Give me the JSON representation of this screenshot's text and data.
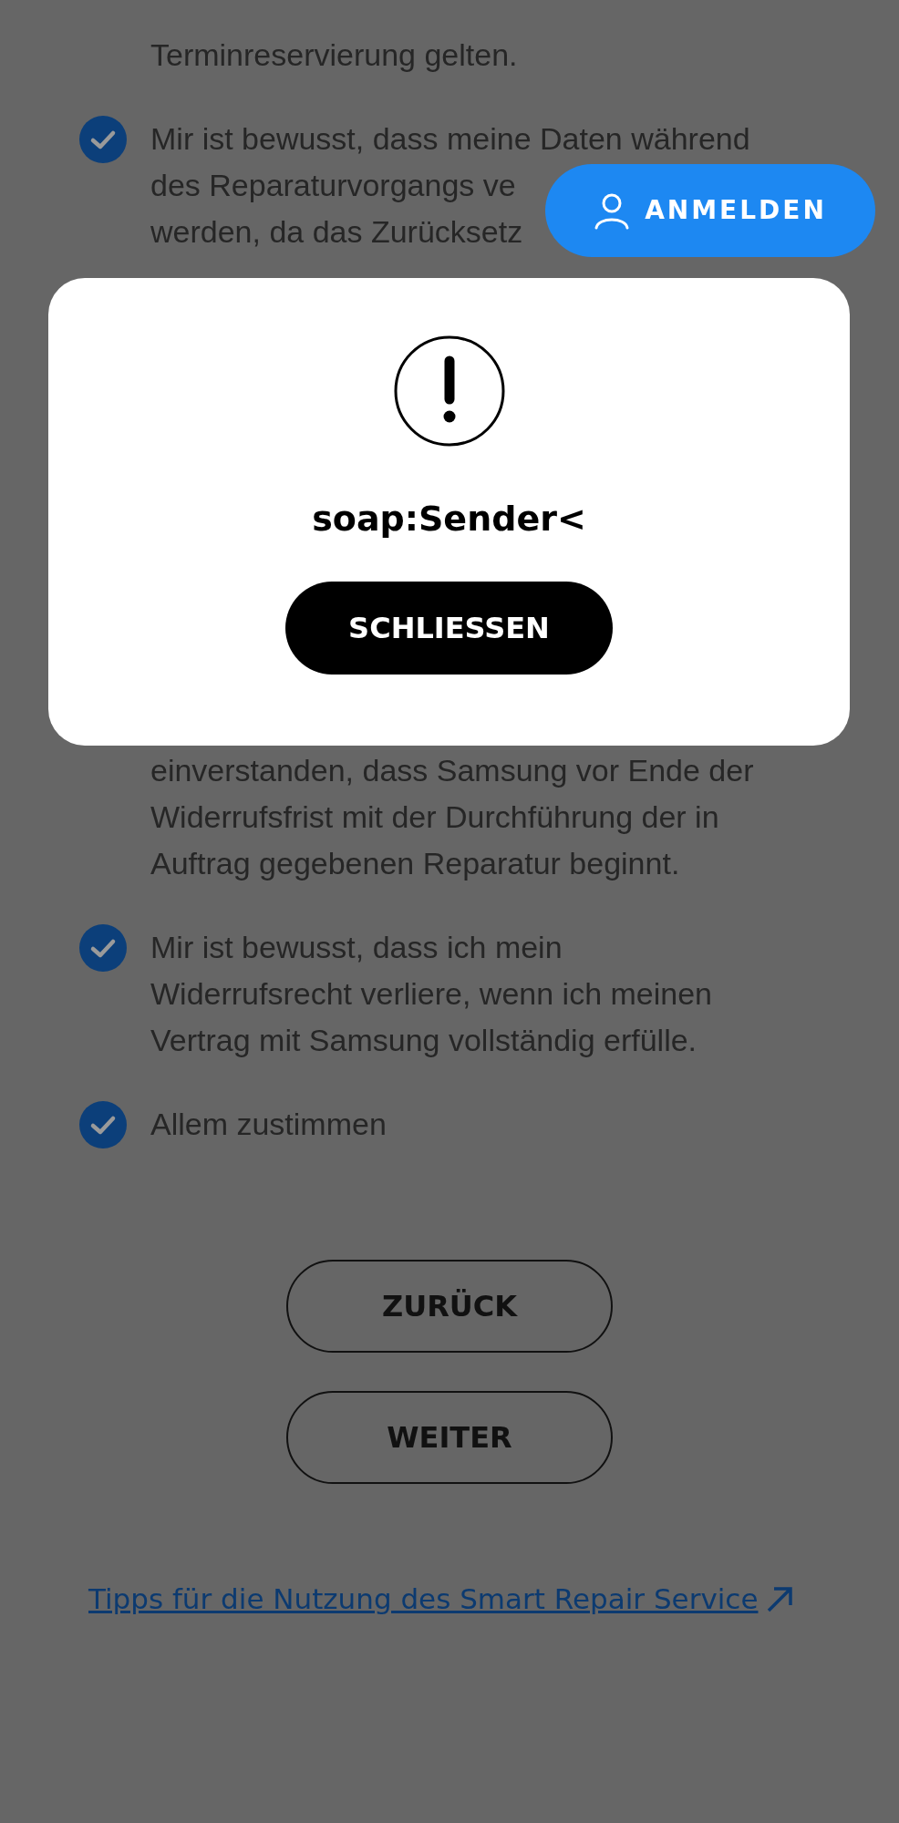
{
  "consents_top": [
    {
      "lines": [
        "Terminreservierung gelten."
      ]
    },
    {
      "checked": true,
      "lines": [
        "Mir ist bewusst, dass meine Daten während",
        "des Reparaturvorgangs ve",
        "werden, da das Zurücksetz"
      ]
    }
  ],
  "consents_bottom": [
    {
      "lines": [
        "einverstanden, dass Samsung vor Ende der",
        "Widerrufsfrist mit der Durchführung der in",
        "Auftrag gegebenen Reparatur beginnt."
      ]
    },
    {
      "checked": true,
      "lines": [
        "Mir ist bewusst, dass ich mein",
        "Widerrufsrecht verliere, wenn ich meinen",
        "Vertrag mit Samsung vollständig erfülle."
      ]
    },
    {
      "checked": true,
      "lines": [
        "Allem zustimmen"
      ]
    }
  ],
  "buttons": [
    "ZURÜCK",
    "WEITER"
  ],
  "help_link": "Tipps für die Nutzung des Smart Repair Service",
  "login_button": "ANMELDEN",
  "dialog": {
    "message": "soap:Sender<",
    "button": "SCHLIESSEN"
  }
}
